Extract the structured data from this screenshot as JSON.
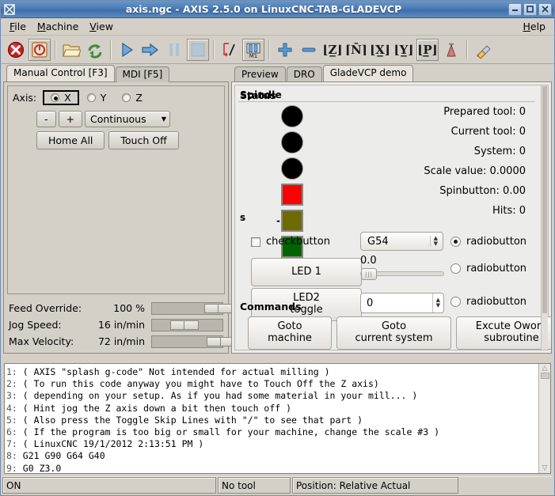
{
  "window": {
    "title": "axis.ngc - AXIS 2.5.0 on LinuxCNC-TAB-GLADEVCP",
    "app_icon": "window-menu-icon",
    "minimize": "–",
    "maximize": "▫",
    "close": "✕"
  },
  "menubar": {
    "items": [
      {
        "label": "File",
        "mnemonic": "F"
      },
      {
        "label": "Machine",
        "mnemonic": "M"
      },
      {
        "label": "View",
        "mnemonic": "V"
      }
    ],
    "help": {
      "label": "Help",
      "mnemonic": "H"
    }
  },
  "toolbar": {
    "buttons": [
      {
        "name": "estop-toggle-icon",
        "tip": "Toggle Emergency Stop",
        "framed": false
      },
      {
        "name": "machine-power-icon",
        "tip": "Toggle Machine Power",
        "framed": true
      },
      {
        "name": "open-file-icon",
        "tip": "Open G-Code file",
        "framed": false
      },
      {
        "name": "reload-file-icon",
        "tip": "Reload G-Code file",
        "framed": false
      },
      {
        "name": "run-program-icon",
        "tip": "Begin executing",
        "framed": false
      },
      {
        "name": "step-program-icon",
        "tip": "Execute next line",
        "framed": false
      },
      {
        "name": "pause-program-icon",
        "tip": "Pause execution",
        "framed": false
      },
      {
        "name": "stop-program-icon",
        "tip": "Stop program",
        "framed": true
      },
      {
        "name": "toggle-skip-lines-icon",
        "tip": "Toggle skip lines with /",
        "framed": false
      },
      {
        "name": "optional-stop-icon",
        "tip": "Toggle optional stop (M1)",
        "framed": true
      },
      {
        "name": "zoom-in-icon",
        "tip": "Zoom in",
        "framed": false
      },
      {
        "name": "zoom-out-icon",
        "tip": "Zoom out",
        "framed": false
      },
      {
        "name": "view-z-icon",
        "tip": "Top view",
        "framed": false
      },
      {
        "name": "view-z2-icon",
        "tip": "Rotated top view",
        "framed": false
      },
      {
        "name": "view-x-icon",
        "tip": "Front view",
        "framed": false
      },
      {
        "name": "view-y-icon",
        "tip": "Side view",
        "framed": false
      },
      {
        "name": "view-p-icon",
        "tip": "Perspective view",
        "framed": true
      },
      {
        "name": "tool-touch-icon",
        "tip": "Tool / probe",
        "framed": false
      },
      {
        "name": "clear-plot-icon",
        "tip": "Clear live plot",
        "framed": false
      }
    ],
    "separators_after": [
      1,
      3,
      7,
      9,
      17
    ]
  },
  "left_panel": {
    "tabs": [
      {
        "label": "Manual Control [F3]",
        "active": true
      },
      {
        "label": "MDI [F5]",
        "active": false
      }
    ],
    "axis": {
      "label": "Axis:",
      "options": [
        {
          "label": "X",
          "selected": true
        },
        {
          "label": "Y",
          "selected": false
        },
        {
          "label": "Z",
          "selected": false
        }
      ]
    },
    "jog": {
      "minus": "-",
      "plus": "+",
      "increment": "Continuous"
    },
    "home_all": "Home All",
    "touch_off": "Touch Off",
    "overrides": [
      {
        "name": "Feed Override:",
        "value": "100 %",
        "fill": 0.8
      },
      {
        "name": "Jog Speed:",
        "value": "16 in/min",
        "fill": 0.32
      },
      {
        "name": "Max Velocity:",
        "value": "72 in/min",
        "fill": 0.84
      }
    ]
  },
  "right_panel": {
    "tabs": [
      {
        "label": "Preview",
        "active": false
      },
      {
        "label": "DRO",
        "active": false
      },
      {
        "label": "GladeVCP demo",
        "active": true
      }
    ],
    "frames": {
      "spindle": "Spindle",
      "status": "Status",
      "commands": "Commands",
      "small_s": "s",
      "small_dash": "-"
    },
    "leds": [
      {
        "name": "led-spindle-fwd",
        "shape": "circle",
        "color": "#000000"
      },
      {
        "name": "led-spindle-rev",
        "shape": "circle",
        "color": "#000000"
      },
      {
        "name": "led-spindle-brake",
        "shape": "circle",
        "color": "#000000"
      },
      {
        "name": "led-red",
        "shape": "square",
        "color": "#fe0000"
      },
      {
        "name": "led-yellow",
        "shape": "square",
        "color": "#6b6b00"
      },
      {
        "name": "led-green",
        "shape": "square",
        "color": "#006400"
      }
    ],
    "status_lines": [
      "Prepared tool: 0",
      "Current tool: 0",
      "System: 0",
      "Scale value: 0.0000",
      "Spinbutton: 0.00",
      "Hits: 0"
    ],
    "controls": {
      "checkbutton": {
        "label": "checkbutton",
        "checked": false
      },
      "combo": {
        "value": "G54"
      },
      "led1_button": "LED 1",
      "led2_button": "LED2\ntoggle",
      "scale_value": "0.0",
      "scale_position": 0.02,
      "spin_value": "0",
      "radiobuttons": [
        {
          "label": "radiobutton",
          "selected": true
        },
        {
          "label": "radiobutton",
          "selected": false
        },
        {
          "label": "radiobutton",
          "selected": false
        }
      ]
    },
    "commands": [
      "Goto\nmachine",
      "Goto\ncurrent system",
      "Excute Oword\nsubroutine"
    ]
  },
  "gcode": {
    "lines": [
      {
        "n": "1:",
        "text": "( AXIS \"splash g-code\" Not intended for actual milling )"
      },
      {
        "n": "2:",
        "text": "( To run this code anyway you might have to Touch Off the Z axis)"
      },
      {
        "n": "3:",
        "text": "( depending on your setup. As if you had some material in your mill... )"
      },
      {
        "n": "4:",
        "text": "( Hint jog the Z axis down a bit then touch off )"
      },
      {
        "n": "5:",
        "text": "( Also press the Toggle Skip Lines with \"/\" to see that part )"
      },
      {
        "n": "6:",
        "text": "( If the program is too big or small for your machine, change the scale #3 )"
      },
      {
        "n": "7:",
        "text": "( LinuxCNC 19/1/2012 2:13:51 PM )"
      },
      {
        "n": "8:",
        "text": "G21 G90 G64 G40"
      },
      {
        "n": "9:",
        "text": "G0 Z3.0"
      }
    ]
  },
  "statusbar": {
    "machine_state": "ON",
    "tool": "No tool",
    "position_mode": "Position: Relative Actual"
  },
  "colors": {
    "title_bar": "#4d7cb4",
    "window_bg": "#d4d0c8",
    "panel_bg": "#ececeb",
    "led_red": "#fe0000",
    "led_yellow": "#6b6b00",
    "led_green": "#006400",
    "led_off": "#000000"
  }
}
